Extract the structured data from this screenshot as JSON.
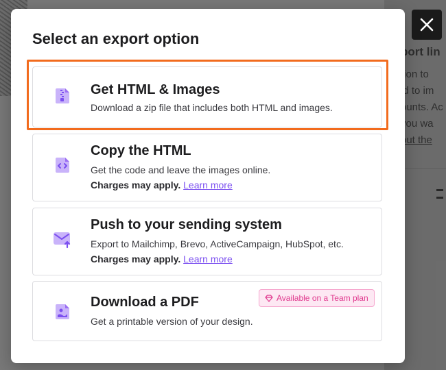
{
  "background": {
    "panel_lines": [
      "port lin",
      "tion to ",
      "ld to im",
      "ounts. Ac",
      "you wa",
      "out the"
    ]
  },
  "modal": {
    "title": "Select an export option",
    "close_icon": "close-icon",
    "options": [
      {
        "title": "Get HTML & Images",
        "description": "Download a zip file that includes both HTML and images.",
        "icon": "zip-file-icon",
        "highlighted": true
      },
      {
        "title": "Copy the HTML",
        "description": "Get the code and leave the images online.",
        "note_bold": "Charges may apply.",
        "note_link": "Learn more",
        "icon": "code-file-icon"
      },
      {
        "title": "Push to your sending system",
        "description": "Export to Mailchimp, Brevo, ActiveCampaign, HubSpot, etc.",
        "note_bold": "Charges may apply.",
        "note_link": "Learn more",
        "icon": "send-email-icon"
      },
      {
        "title": "Download a PDF",
        "description": "Get a printable version of your design.",
        "badge": "Available on a Team plan",
        "badge_icon": "diamond-icon",
        "icon": "pdf-image-file-icon"
      }
    ]
  },
  "colors": {
    "accent": "#7b4ff0",
    "icon_purple": "#9b6ef3",
    "highlight_border": "#f26b1d",
    "badge_pink": "#e0378d"
  }
}
